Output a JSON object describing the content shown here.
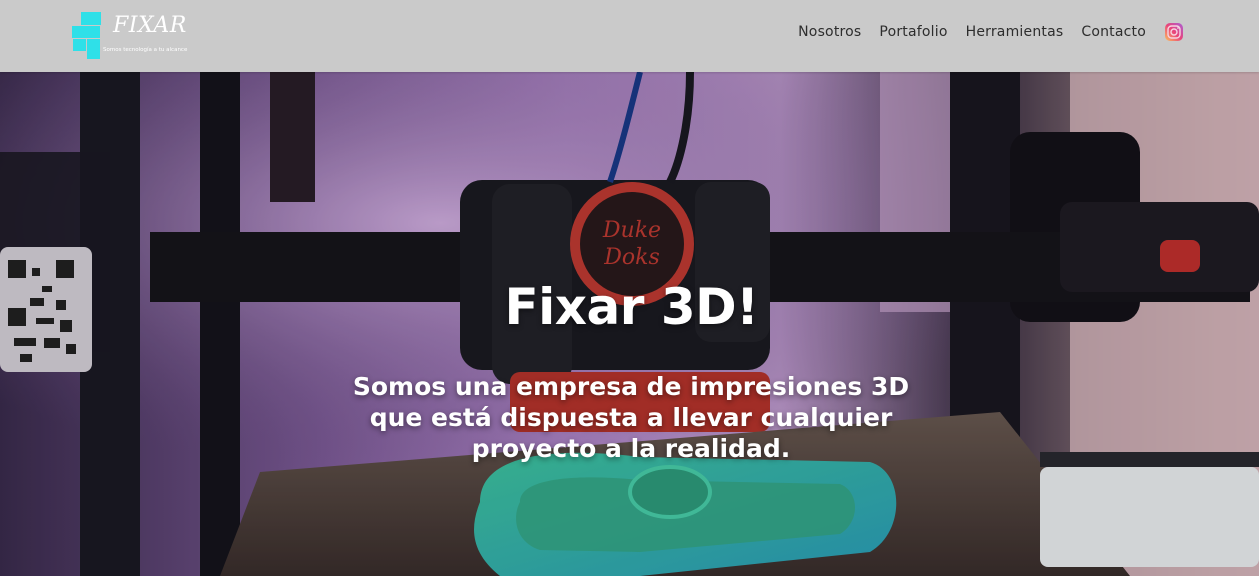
{
  "brand": {
    "name": "FIXAR",
    "tagline": "Somos tecnología a tu alcance",
    "accent": "#2fe0e8"
  },
  "header": {
    "background": "#cacaca"
  },
  "nav": {
    "items": [
      {
        "label": "Nosotros"
      },
      {
        "label": "Portafolio"
      },
      {
        "label": "Herramientas"
      },
      {
        "label": "Contacto"
      }
    ],
    "social_icon": "instagram-icon"
  },
  "hero": {
    "title": "Fixar 3D!",
    "text": "Somos una empresa de impresiones 3D que está dispuesta a llevar cualquier proyecto a la realidad.",
    "printer_head_label": "Duke Doks",
    "background_description_colors": [
      "#b58acf",
      "#1c1c24",
      "#2fb8a0"
    ]
  }
}
